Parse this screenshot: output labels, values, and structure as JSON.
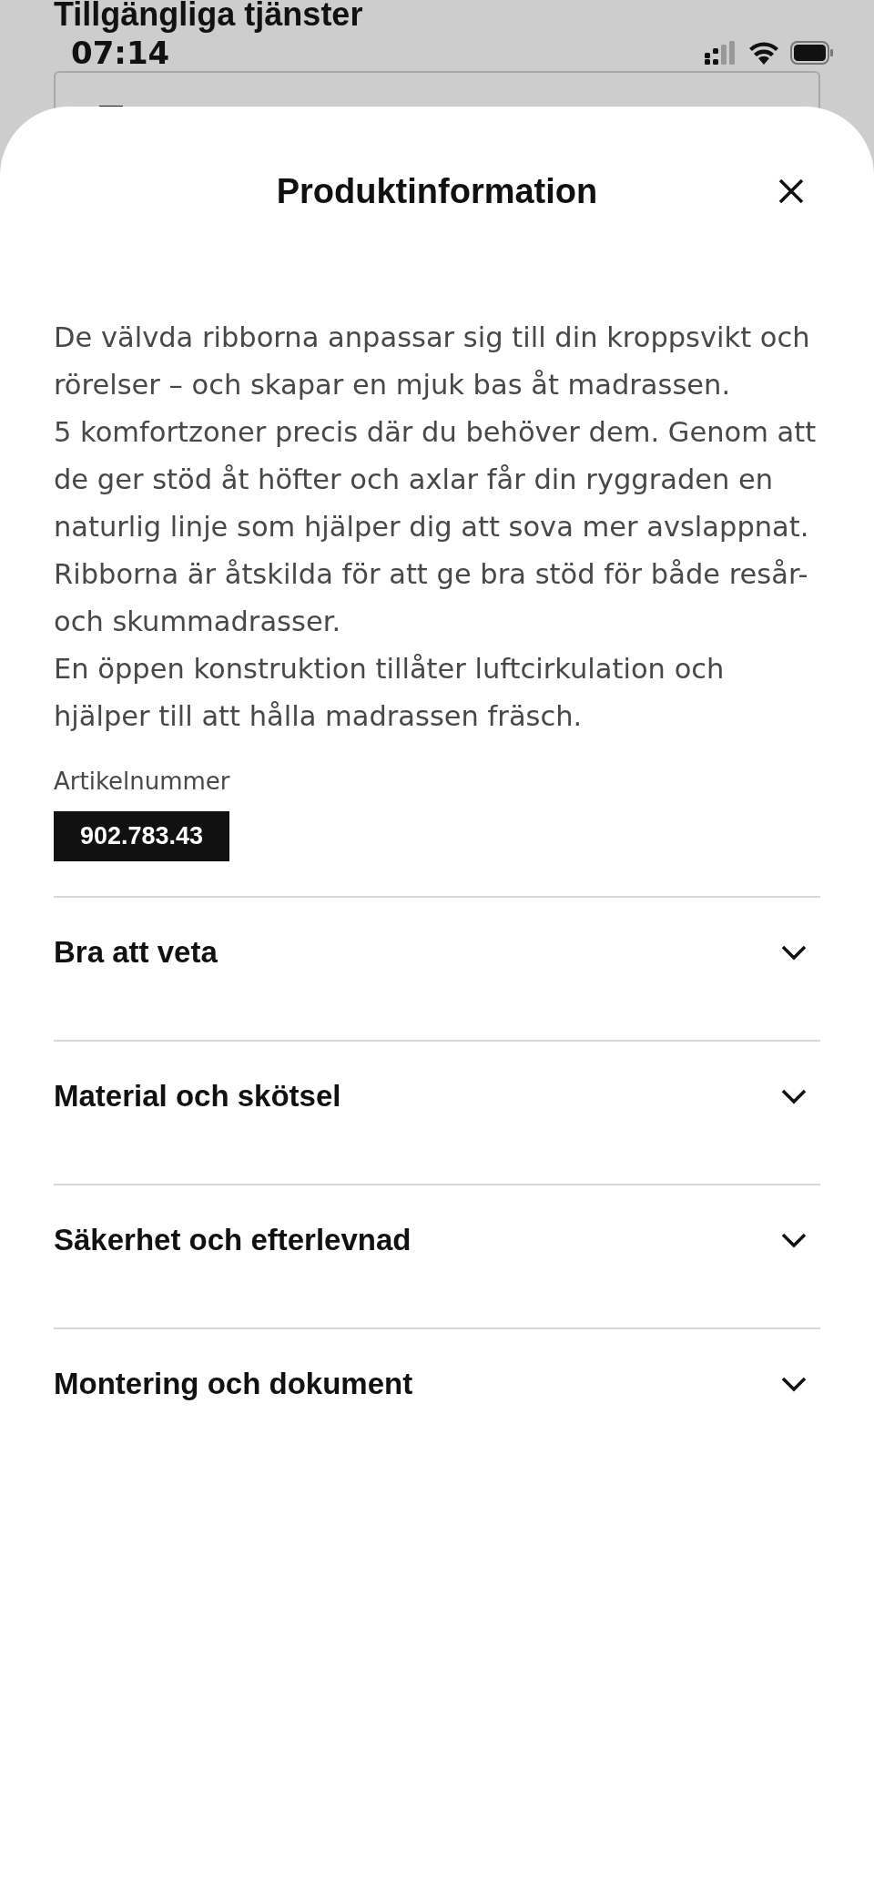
{
  "background": {
    "heading": "Tillgängliga tjänster"
  },
  "status_bar": {
    "time": "07:14"
  },
  "sheet": {
    "title": "Produktinformation",
    "paragraphs": [
      "De välvda ribborna anpassar sig till din kroppsvikt och rörelser – och skapar en mjuk bas åt madrassen.",
      "5 komfortzoner precis där du behöver dem. Genom att de ger stöd åt höfter och axlar får din ryggraden en naturlig linje som hjälper dig att sova mer avslappnat.",
      "Ribborna är åtskilda för att ge bra stöd för både resår- och skummadrasser.",
      "En öppen konstruktion tillåter luftcirkulation och hjälper till att hålla madrassen fräsch."
    ],
    "article_label": "Artikelnummer",
    "article_number": "902.783.43",
    "sections": [
      {
        "title": "Bra att veta",
        "expanded": false
      },
      {
        "title": "Material och skötsel",
        "expanded": false
      },
      {
        "title": "Säkerhet och efterlevnad",
        "expanded": false
      },
      {
        "title": "Montering och dokument",
        "expanded": false
      }
    ]
  }
}
